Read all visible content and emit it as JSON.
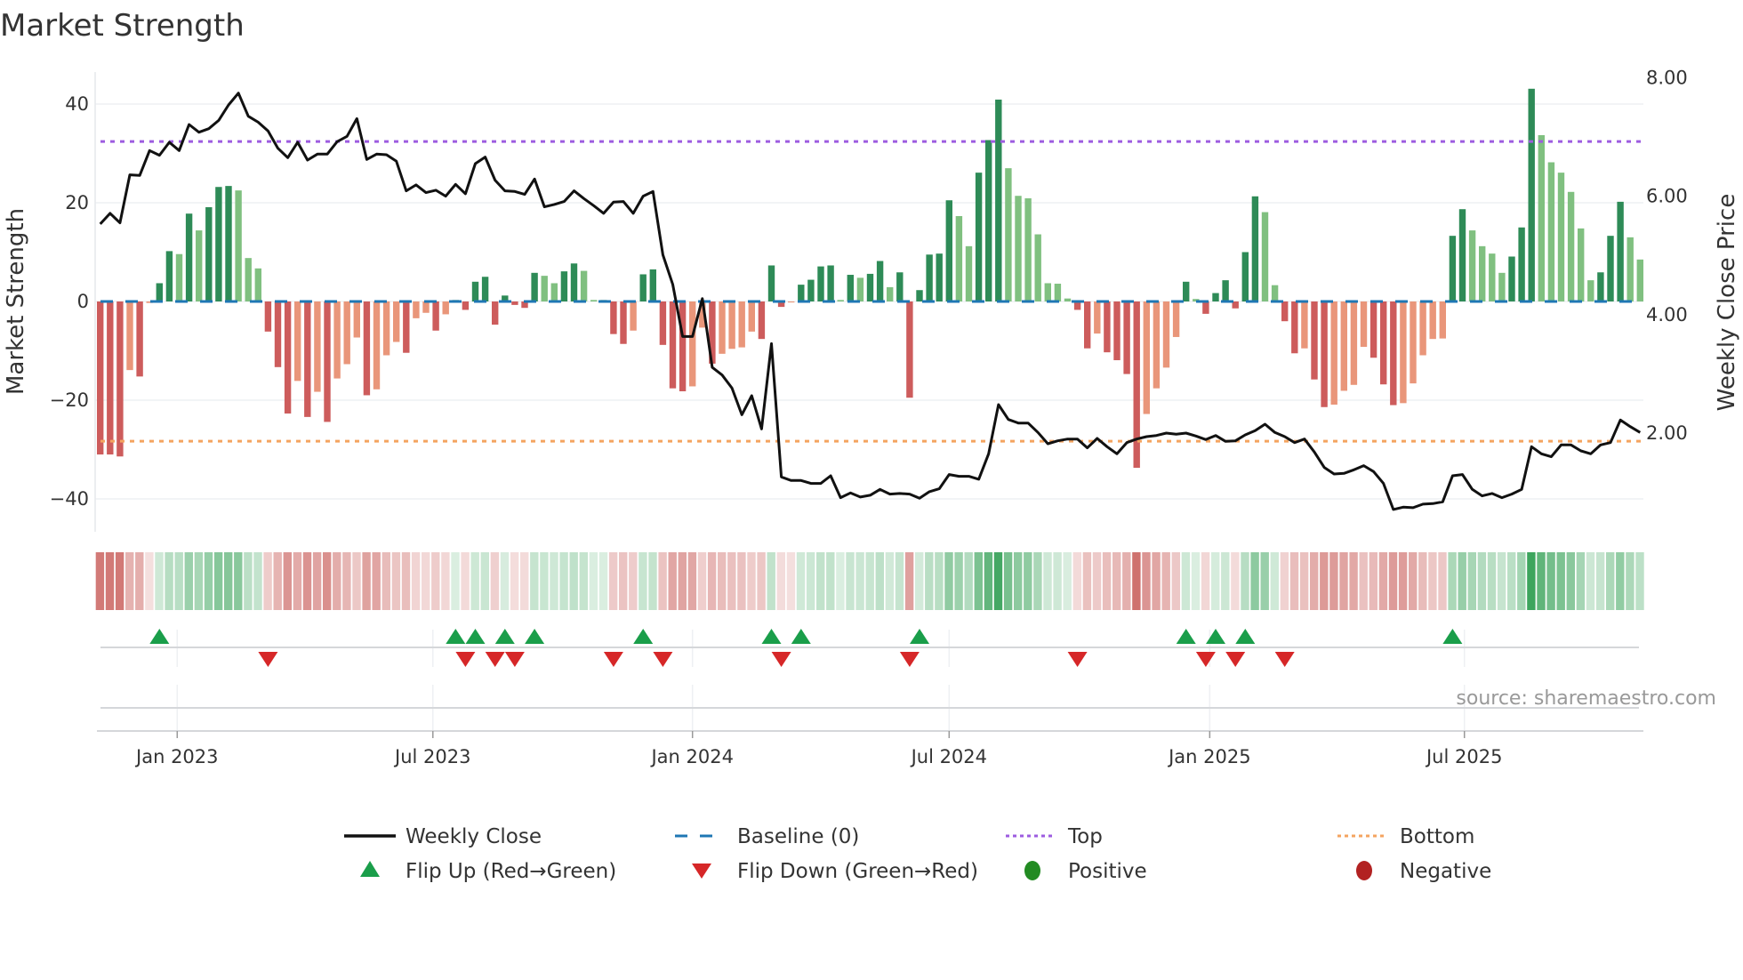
{
  "title": "Market Strength",
  "source": "source: sharemaestro.com",
  "colors": {
    "rising_positive": "#2e8b57",
    "falling_positive": "#80c080",
    "falling_negative": "#cd5c5c",
    "rising_negative": "#e9967a",
    "close_line": "#111111",
    "baseline": "#1f77b4",
    "top": "#9d5ce0",
    "bottom": "#f4a460",
    "flip_up": "#1a9e4a",
    "flip_down": "#d62728",
    "positive": "#228b22",
    "negative": "#b22222"
  },
  "legend": {
    "weekly_close": "Weekly Close",
    "baseline": "Baseline (0)",
    "top": "Top",
    "bottom": "Bottom",
    "flip_up": "Flip Up (Red→Green)",
    "flip_down": "Flip Down (Green→Red)",
    "positive": "Positive",
    "negative": "Negative"
  },
  "chart_data": {
    "type": "bar",
    "title": "Market Strength",
    "ylabel": "Market Strength",
    "y2label": "Weekly Close Price",
    "ylim": [
      -43,
      46
    ],
    "y2lim": [
      0.0,
      8.3
    ],
    "yticks": [
      "40",
      "20",
      "0",
      "−20",
      "−40"
    ],
    "ytick_values": [
      40,
      20,
      0,
      -20,
      -40
    ],
    "y2ticks": [
      "8.00",
      "6.00",
      "4.00",
      "2.00"
    ],
    "y2tick_values": [
      8,
      6,
      4,
      2
    ],
    "xticks": [
      "Jan 2023",
      "Jul 2023",
      "Jan 2024",
      "Jul 2024",
      "Jan 2025",
      "Jul 2025"
    ],
    "xtick_week_index": [
      7.8,
      33.7,
      60.0,
      86.0,
      112.4,
      138.2
    ],
    "top_level": 32.4,
    "bottom_level": -28.3,
    "baseline": 0,
    "grid": true,
    "legend_position": "bottom",
    "strength": [
      -31.0,
      -31.0,
      -31.4,
      -13.9,
      -15.2,
      -0.3,
      3.7,
      10.2,
      9.6,
      17.8,
      14.4,
      19.1,
      23.2,
      23.4,
      22.5,
      8.8,
      6.7,
      -6.1,
      -13.3,
      -22.7,
      -16.1,
      -23.4,
      -18.3,
      -24.4,
      -15.6,
      -12.7,
      -7.3,
      -19.0,
      -17.8,
      -10.9,
      -8.2,
      -10.4,
      -3.4,
      -2.3,
      -5.9,
      -2.6,
      0.3,
      -1.7,
      4.0,
      5.0,
      -4.7,
      1.2,
      -0.7,
      -1.3,
      5.8,
      5.2,
      3.7,
      6.1,
      7.7,
      6.2,
      0.3,
      0.3,
      -6.6,
      -8.6,
      -5.9,
      5.5,
      6.5,
      -8.8,
      -17.6,
      -18.2,
      -17.2,
      -5.3,
      -12.6,
      -10.6,
      -9.6,
      -9.3,
      -6.1,
      -7.6,
      7.3,
      -1.1,
      -0.2,
      3.4,
      4.4,
      7.1,
      7.3,
      0.3,
      5.4,
      4.8,
      5.6,
      8.2,
      2.9,
      5.9,
      -19.5,
      2.3,
      9.5,
      9.7,
      20.5,
      17.3,
      11.2,
      26.1,
      32.7,
      40.9,
      27.0,
      21.4,
      20.9,
      13.6,
      3.7,
      3.6,
      0.6,
      -1.7,
      -9.5,
      -6.5,
      -10.3,
      -11.9,
      -14.7,
      -33.7,
      -22.8,
      -17.6,
      -13.4,
      -7.2,
      4.0,
      0.5,
      -2.5,
      1.7,
      4.3,
      -1.4,
      10.0,
      21.3,
      18.1,
      3.3,
      -4.0,
      -10.5,
      -9.5,
      -15.8,
      -21.4,
      -20.9,
      -18.1,
      -16.9,
      -9.2,
      -11.4,
      -16.8,
      -21.0,
      -20.6,
      -16.6,
      -10.9,
      -7.6,
      -7.5,
      13.3,
      18.7,
      14.4,
      11.2,
      9.7,
      5.8,
      9.1,
      15.0,
      43.1,
      33.7,
      28.2,
      26.1,
      22.2,
      14.8,
      4.3,
      5.9,
      13.3,
      20.2,
      13.0,
      8.5
    ],
    "weekly_close": [
      5.53,
      5.71,
      5.55,
      6.36,
      6.35,
      6.77,
      6.69,
      6.91,
      6.77,
      7.21,
      7.08,
      7.14,
      7.28,
      7.54,
      7.74,
      7.35,
      7.25,
      7.1,
      6.81,
      6.65,
      6.91,
      6.61,
      6.71,
      6.71,
      6.92,
      7.01,
      7.31,
      6.62,
      6.71,
      6.7,
      6.59,
      6.09,
      6.19,
      6.06,
      6.1,
      6.0,
      6.2,
      6.04,
      6.55,
      6.66,
      6.27,
      6.09,
      6.08,
      6.03,
      6.29,
      5.82,
      5.86,
      5.91,
      6.09,
      5.96,
      5.84,
      5.71,
      5.9,
      5.91,
      5.71,
      6.0,
      6.08,
      5.01,
      4.51,
      3.63,
      3.63,
      4.27,
      3.11,
      2.98,
      2.76,
      2.31,
      2.63,
      2.07,
      3.51,
      1.26,
      1.2,
      1.2,
      1.15,
      1.15,
      1.28,
      0.91,
      0.99,
      0.92,
      0.95,
      1.05,
      0.97,
      0.98,
      0.97,
      0.9,
      1.01,
      1.06,
      1.3,
      1.27,
      1.27,
      1.22,
      1.65,
      2.48,
      2.23,
      2.17,
      2.17,
      2.01,
      1.82,
      1.87,
      1.9,
      1.9,
      1.75,
      1.91,
      1.77,
      1.65,
      1.84,
      1.9,
      1.94,
      1.96,
      2.0,
      1.98,
      2.0,
      1.95,
      1.89,
      1.96,
      1.86,
      1.87,
      1.97,
      2.04,
      2.15,
      2.01,
      1.94,
      1.84,
      1.9,
      1.68,
      1.42,
      1.31,
      1.32,
      1.38,
      1.45,
      1.35,
      1.15,
      0.71,
      0.75,
      0.74,
      0.8,
      0.81,
      0.84,
      1.28,
      1.3,
      1.05,
      0.94,
      0.98,
      0.91,
      0.97,
      1.05,
      1.77,
      1.65,
      1.6,
      1.8,
      1.8,
      1.7,
      1.65,
      1.8,
      1.84,
      2.22,
      2.11,
      2.01
    ],
    "flip_up_weeks": [
      7,
      37,
      39,
      42,
      45,
      56,
      69,
      72,
      84,
      111,
      114,
      117,
      138
    ],
    "flip_down_weeks": [
      18,
      38,
      41,
      43,
      53,
      58,
      70,
      83,
      100,
      113,
      116,
      121
    ]
  }
}
